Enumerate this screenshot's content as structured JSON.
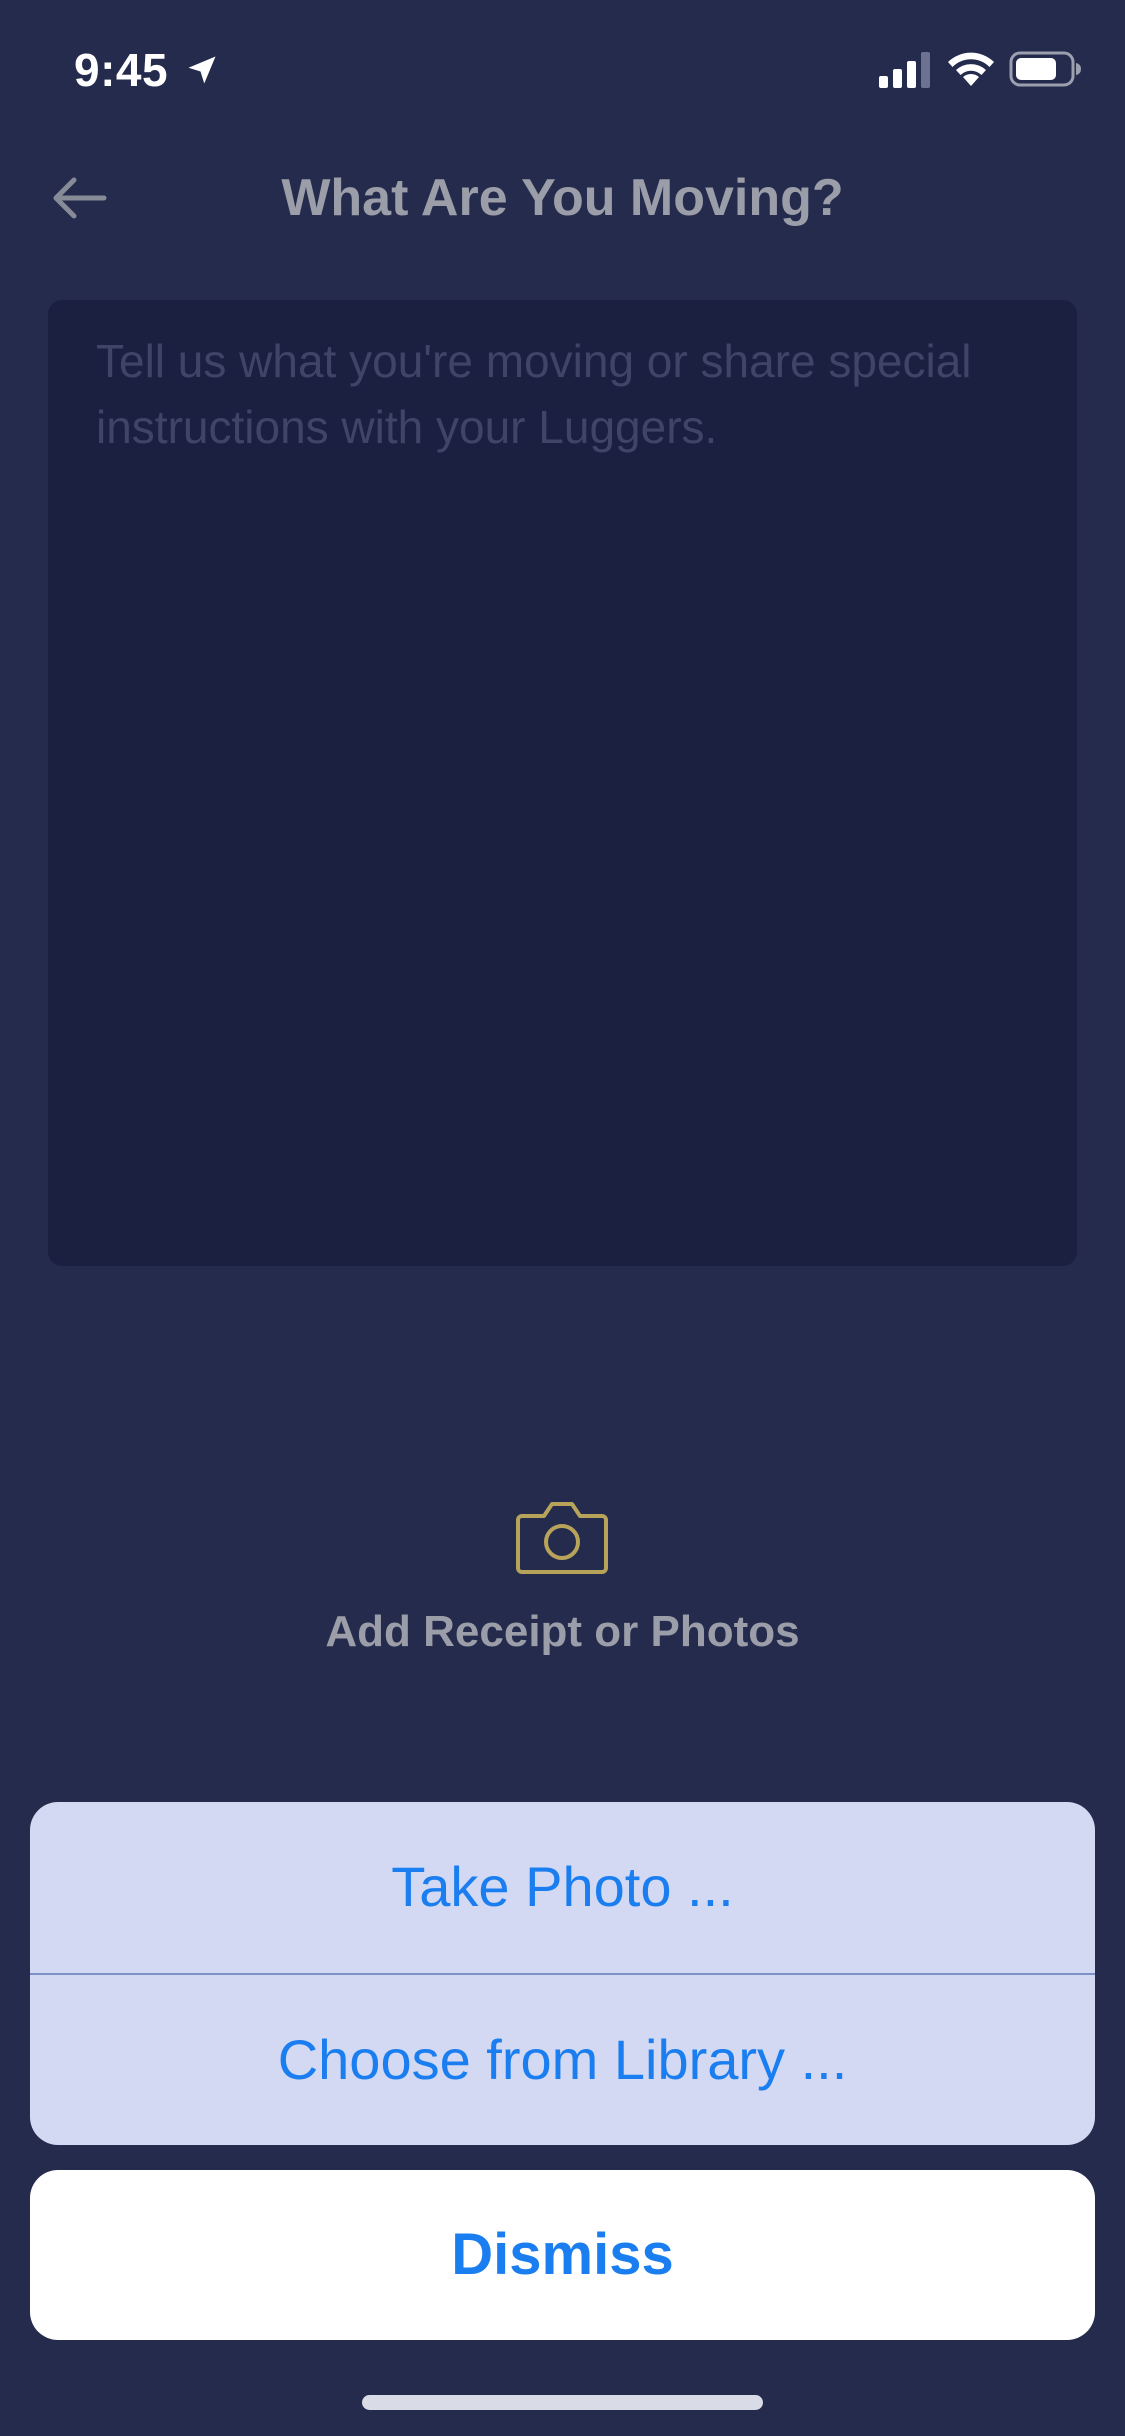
{
  "status_bar": {
    "time": "9:45",
    "icons": [
      "location-arrow-icon",
      "cellular-signal-icon",
      "wifi-icon",
      "battery-icon"
    ]
  },
  "header": {
    "back_icon": "arrow-left-icon",
    "title": "What Are You Moving?"
  },
  "notes": {
    "value": "",
    "placeholder": "Tell us what you're moving or share special instructions with your Luggers."
  },
  "attachments": {
    "icon": "camera-icon",
    "label": "Add Receipt or Photos"
  },
  "action_sheet": {
    "options": [
      {
        "label": "Take Photo ..."
      },
      {
        "label": "Choose from Library ..."
      }
    ],
    "dismiss_label": "Dismiss"
  },
  "colors": {
    "background": "#252b4d",
    "text_field_background": "#1b2040",
    "muted_text": "#9b9ea8",
    "camera_icon": "#b8a35a",
    "action_text": "#1b7ef0",
    "action_sheet_background": "#d3d9f2"
  }
}
